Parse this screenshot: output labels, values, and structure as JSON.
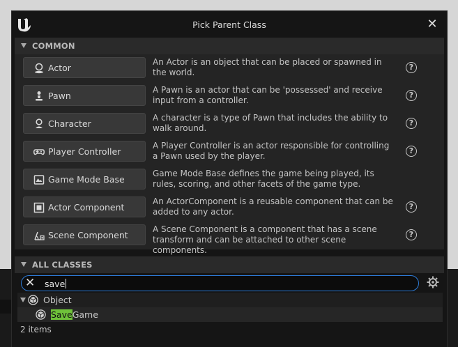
{
  "dialog": {
    "title": "Pick Parent Class",
    "close_glyph": "✕",
    "logo_icon": "unreal-logo-icon"
  },
  "common": {
    "header": "COMMON",
    "help_glyph": "?",
    "items": [
      {
        "label": "Actor",
        "icon": "actor-icon",
        "description": "An Actor is an object that can be placed or spawned in the world.",
        "help": true
      },
      {
        "label": "Pawn",
        "icon": "pawn-icon",
        "description": "A Pawn is an actor that can be 'possessed' and receive input from a controller.",
        "help": true
      },
      {
        "label": "Character",
        "icon": "character-icon",
        "description": "A character is a type of Pawn that includes the ability to walk around.",
        "help": true
      },
      {
        "label": "Player Controller",
        "icon": "gamepad-icon",
        "description": "A Player Controller is an actor responsible for controlling a Pawn used by the player.",
        "help": true
      },
      {
        "label": "Game Mode Base",
        "icon": "game-mode-icon",
        "description": "Game Mode Base defines the game being played, its rules, scoring, and other facets of the game type.",
        "help": false
      },
      {
        "label": "Actor Component",
        "icon": "actor-component-icon",
        "description": "An ActorComponent is a reusable component that can be added to any actor.",
        "help": true
      },
      {
        "label": "Scene Component",
        "icon": "scene-component-icon",
        "description": "A Scene Component is a component that has a scene transform and can be attached to other scene components.",
        "help": true
      }
    ]
  },
  "all_classes": {
    "header": "ALL CLASSES",
    "search": {
      "value": "save",
      "clear_glyph": "✕"
    },
    "tree": {
      "root": {
        "label": "Object",
        "icon": "object-class-icon"
      },
      "child": {
        "match": "Save",
        "rest": "Game",
        "icon": "object-class-icon"
      }
    },
    "count": "2 items"
  },
  "colors": {
    "accent": "#2d7bd6",
    "highlight": "#6fc23a",
    "button": "#383838",
    "panel": "#242424"
  }
}
